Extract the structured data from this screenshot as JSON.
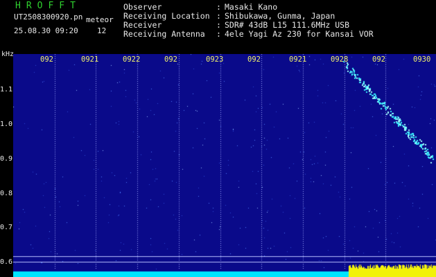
{
  "header": {
    "app_title": "HROFFT",
    "filename": "UT2508300920.pn",
    "mode": "meteor",
    "datetime": "25.08.30 09:20",
    "count": "12",
    "info": [
      {
        "key": "Observer",
        "sep": ":",
        "value": "Masaki Kano"
      },
      {
        "key": "Receiving Location",
        "sep": ":",
        "value": "Shibukawa, Gunma, Japan"
      },
      {
        "key": "Receiver",
        "sep": ":",
        "value": "SDR# 43dB L15 111.6MHz USB"
      },
      {
        "key": "Receiving Antenna",
        "sep": ":",
        "value": "4ele Yagi Az 230 for Kansai VOR"
      }
    ]
  },
  "axis": {
    "y_unit": "kHz",
    "y_ticks": [
      "1.1",
      "1.0",
      "0.9",
      "0.8",
      "0.7",
      "0.6"
    ],
    "x_ticks": [
      "092",
      "0921",
      "0922",
      "092",
      "0923",
      "092",
      "0921",
      "0928",
      "092",
      "0930"
    ]
  },
  "colors": {
    "background": "#0a0a8a",
    "noise_speck": "#4a7cff",
    "meteor_trail": "#38f0ff",
    "bottom_band": "#00e5ff",
    "burst": "#f2f20a",
    "time_label": "#f2f26a",
    "title": "#2fd12f"
  }
}
